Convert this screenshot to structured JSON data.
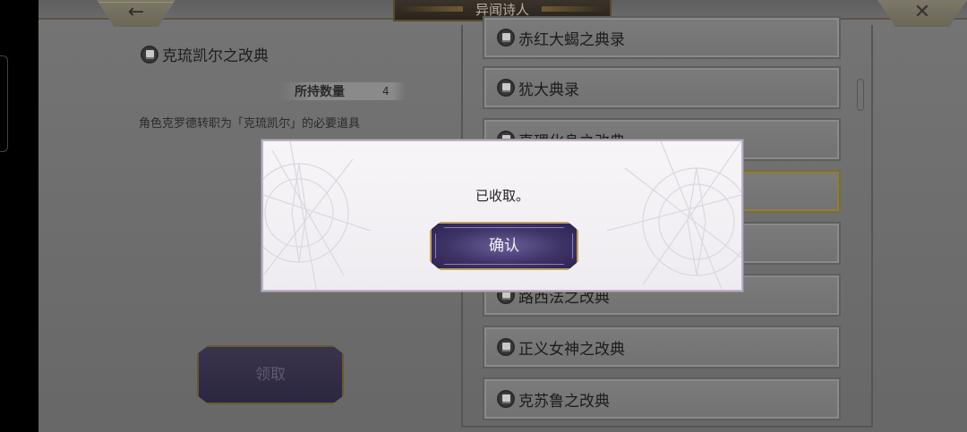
{
  "header": {
    "title": "异闻诗人",
    "back_icon": "←",
    "close_icon": "✕"
  },
  "detail": {
    "item_name": "克琉凯尔之改典",
    "quantity_label": "所持数量",
    "quantity_value": "4",
    "description": "角色克罗德转职为「克琉凯尔」的必要道具",
    "claim_label": "领取"
  },
  "list": {
    "items": [
      {
        "label": "赤红大蝎之典录"
      },
      {
        "label": "犹大典录"
      },
      {
        "label": "真理化身之改典"
      },
      {
        "label": ""
      },
      {
        "label": ""
      },
      {
        "label": "路西法之改典"
      },
      {
        "label": "正义女神之改典"
      },
      {
        "label": "克苏鲁之改典"
      }
    ]
  },
  "dialog": {
    "message": "已收取。",
    "confirm_label": "确认"
  },
  "colors": {
    "dialog_bg": "#f4f2f6",
    "confirm_btn": "#3e3467",
    "gold_border": "#c3a55c"
  }
}
